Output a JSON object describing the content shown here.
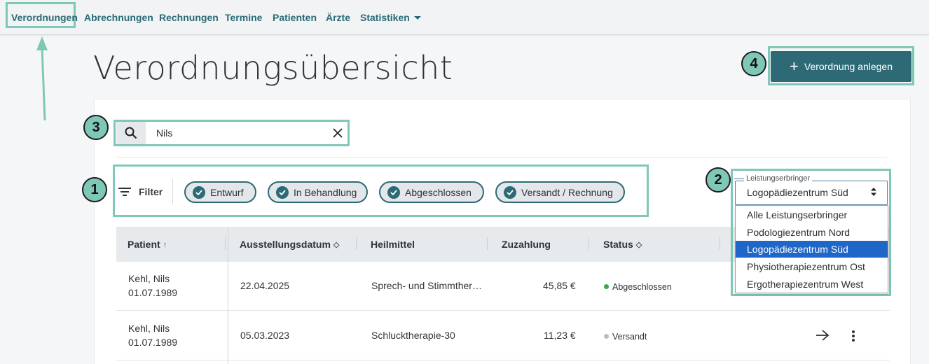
{
  "nav": {
    "items": [
      {
        "label": "Verordnungen"
      },
      {
        "label": "Abrechnungen"
      },
      {
        "label": "Rechnungen"
      },
      {
        "label": "Termine"
      },
      {
        "label": "Patienten"
      },
      {
        "label": "Ärzte"
      },
      {
        "label": "Statistiken"
      }
    ]
  },
  "page": {
    "title": "Verordnungsübersicht",
    "create_label": "Verordnung anlegen"
  },
  "annotations": {
    "b1": "1",
    "b2": "2",
    "b3": "3",
    "b4": "4"
  },
  "search": {
    "value": "Nils",
    "placeholder": ""
  },
  "filter": {
    "label": "Filter",
    "chips": [
      {
        "label": "Entwurf",
        "checked": true
      },
      {
        "label": "In Behandlung",
        "checked": true
      },
      {
        "label": "Abgeschlossen",
        "checked": true
      },
      {
        "label": "Versandt / Rechnung",
        "checked": true
      }
    ]
  },
  "provider": {
    "legend": "Leistungserbringer",
    "selected": "Logopädiezentrum Süd",
    "options": [
      {
        "label": "Alle Leistungserbringer"
      },
      {
        "label": "Podologiezentrum Nord"
      },
      {
        "label": "Logopädiezentrum Süd"
      },
      {
        "label": "Physiotherapiezentrum Ost"
      },
      {
        "label": "Ergotherapiezentrum West"
      }
    ]
  },
  "table": {
    "columns": [
      {
        "label": "Patient"
      },
      {
        "label": "Ausstellungsdatum"
      },
      {
        "label": "Heilmittel"
      },
      {
        "label": "Zuzahlung"
      },
      {
        "label": "Status"
      }
    ],
    "rows": [
      {
        "name": "Kehl, Nils",
        "dob": "01.07.1989",
        "date": "22.04.2025",
        "remedy": "Sprech- und Stimmther…",
        "copay": "45,85 €",
        "status": "Abgeschlossen",
        "status_color": "#3aa845"
      },
      {
        "name": "Kehl, Nils",
        "dob": "01.07.1989",
        "date": "05.03.2023",
        "remedy": "Schlucktherapie-30",
        "copay": "11,23 €",
        "status": "Versandt",
        "status_color": "#bdbdbd"
      }
    ]
  },
  "colors": {
    "accent": "#2d6a76",
    "annotation": "#7fc7b7",
    "selection": "#1f66c9"
  }
}
